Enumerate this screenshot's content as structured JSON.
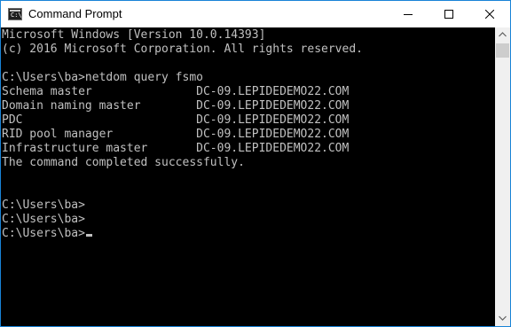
{
  "window": {
    "title": "Command Prompt",
    "icon": "cmd-icon",
    "icon_glyph": "C:\\_"
  },
  "controls": {
    "minimize": "minimize-icon",
    "maximize": "maximize-icon",
    "close": "close-icon"
  },
  "console": {
    "lines": [
      "Microsoft Windows [Version 10.0.14393]",
      "(c) 2016 Microsoft Corporation. All rights reserved.",
      "",
      "C:\\Users\\ba>netdom query fsmo",
      "Schema master               DC-09.LEPIDEDEMO22.COM",
      "Domain naming master        DC-09.LEPIDEDEMO22.COM",
      "PDC                         DC-09.LEPIDEDEMO22.COM",
      "RID pool manager            DC-09.LEPIDEDEMO22.COM",
      "Infrastructure master       DC-09.LEPIDEDEMO22.COM",
      "The command completed successfully.",
      "",
      "",
      "C:\\Users\\ba>",
      "C:\\Users\\ba>",
      "C:\\Users\\ba>"
    ]
  },
  "colors": {
    "console_bg": "#000000",
    "console_fg": "#c0c0c0",
    "window_border": "#1883d7"
  }
}
